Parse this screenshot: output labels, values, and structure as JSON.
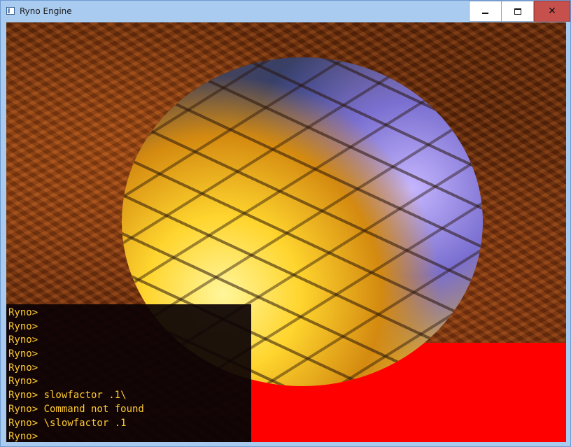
{
  "window": {
    "title": "Ryno Engine",
    "minimize_icon": "minimize-icon",
    "maximize_icon": "maximize-icon",
    "close_symbol": "✕"
  },
  "scene": {
    "background_color": "#7a3510",
    "floor_color": "#ff0000",
    "sphere_highlight_color": "#ffd52e",
    "sphere_shadow_color": "#4f5fd0"
  },
  "console": {
    "text_color": "#ffcc33",
    "lines": [
      "Ryno>",
      "Ryno>",
      "Ryno>",
      "Ryno>",
      "Ryno>",
      "Ryno>",
      "Ryno> slowfactor .1\\",
      "Ryno> Command not found",
      "Ryno> \\slowfactor .1",
      "Ryno>"
    ]
  }
}
